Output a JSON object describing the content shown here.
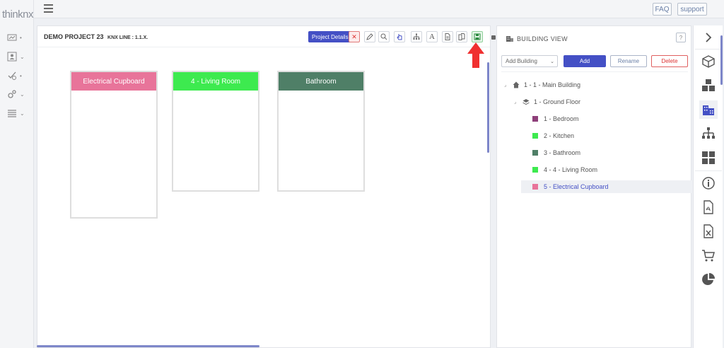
{
  "app": {
    "logo": "thinknx"
  },
  "topbar": {
    "faq": "FAQ",
    "support": "support"
  },
  "canvas": {
    "project_title": "DEMO PROJECT 23",
    "line_label": "KNX LINE : 1.1.X.",
    "project_details_label": "Project Details",
    "rooms": [
      {
        "name": "Electrical Cupboard",
        "color": "#e8749a"
      },
      {
        "name": "4 - Living Room",
        "color": "#3dea4f"
      },
      {
        "name": "Bathroom",
        "color": "#4f7f67"
      }
    ]
  },
  "building": {
    "title": "BUILDING VIEW",
    "help": "?",
    "add_select": "Add Building",
    "add_label": "Add",
    "rename_label": "Rename",
    "delete_label": "Delete",
    "tree": {
      "building": "1 - 1 - Main Building",
      "floor": "1 - Ground Floor",
      "rooms": [
        {
          "label": "1 - Bedroom",
          "color": "#8e3f7a"
        },
        {
          "label": "2 - Kitchen",
          "color": "#3dea4f"
        },
        {
          "label": "3 - Bathroom",
          "color": "#4f7f67"
        },
        {
          "label": "4 - 4 - Living Room",
          "color": "#3dea4f"
        },
        {
          "label": "5 - Electrical Cupboard",
          "color": "#e8749a"
        }
      ]
    }
  },
  "icons": {
    "left": [
      "monitor-icon",
      "user-card-icon",
      "check-gear-icon",
      "gears-icon",
      "list-icon"
    ],
    "toolbar": [
      "close-icon",
      "pen-icon",
      "search-icon",
      "pointer-icon",
      "hierarchy-icon",
      "text-icon",
      "document-icon",
      "documents-icon",
      "save-icon"
    ],
    "right": [
      "chevron-right-icon",
      "cube-icon",
      "cubes-icon",
      "building-icon",
      "sitemap-icon",
      "grid-icon",
      "info-icon",
      "pdf-icon",
      "excel-icon",
      "cart-icon",
      "pie-chart-icon"
    ]
  },
  "colors": {
    "accent": "#4450c5",
    "danger": "#dd3333",
    "save": "#2b8a3e",
    "arrow": "#f03030"
  }
}
